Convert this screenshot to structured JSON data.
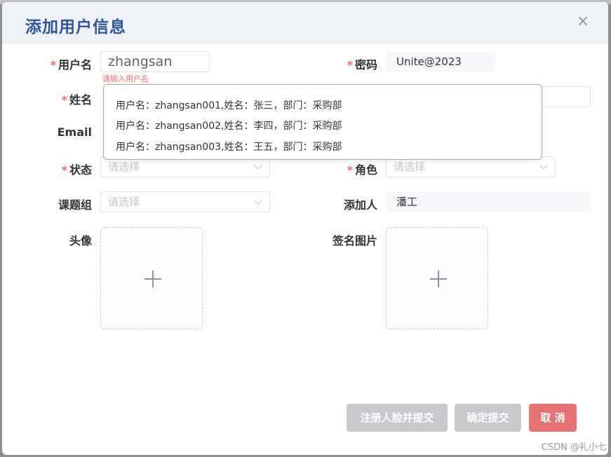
{
  "dialog": {
    "title": "添加用户信息",
    "close_glyph": "×"
  },
  "form": {
    "username": {
      "required_mark": "*",
      "label": "用户名",
      "value": "zhangsan",
      "error": "请输入用户名"
    },
    "password": {
      "required_mark": "*",
      "label": "密码",
      "value": "Unite@2023"
    },
    "name": {
      "required_mark": "*",
      "label": "姓名"
    },
    "email": {
      "label": "Email"
    },
    "status": {
      "required_mark": "*",
      "label": "状态",
      "placeholder": "请选择"
    },
    "role": {
      "required_mark": "*",
      "label": "角色",
      "placeholder": "请选择"
    },
    "group": {
      "label": "课题组",
      "placeholder": "请选择"
    },
    "adder": {
      "label": "添加人",
      "value": "潘工"
    },
    "avatar": {
      "label": "头像"
    },
    "signature": {
      "label": "签名图片"
    }
  },
  "suggestions": [
    "用户名：zhangsan001,姓名：张三，部门：采购部",
    "用户名：zhangsan002,姓名：李四，部门：采购部",
    "用户名：zhangsan003,姓名：王五，部门：采购部"
  ],
  "buttons": {
    "face_submit": "注册人脸并提交",
    "confirm": "确定提交",
    "cancel": "取 消"
  },
  "watermark": "CSDN @礼小七",
  "icons": {
    "close": "close-icon",
    "plus": "plus-icon",
    "chevron": "chevron-down-icon"
  },
  "colors": {
    "title": "#2f5597",
    "required": "#f56c6c",
    "cancel_button": "#e57373",
    "disabled_button": "#c8c9cc"
  }
}
